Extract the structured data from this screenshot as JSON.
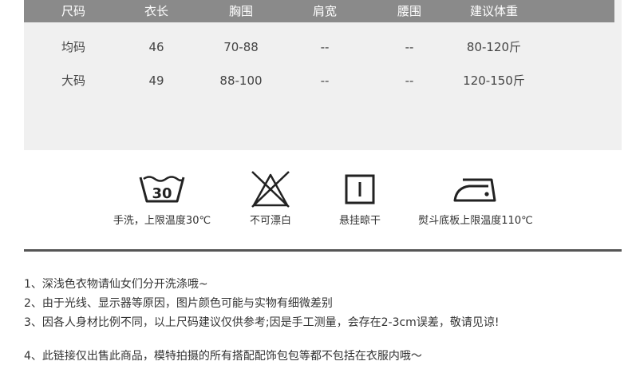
{
  "size_table": {
    "headers": [
      "尺码",
      "衣长",
      "胸围",
      "肩宽",
      "腰围",
      "建议体重"
    ],
    "rows": [
      [
        "均码",
        "46",
        "70-88",
        "--",
        "--",
        "80-120斤"
      ],
      [
        "大码",
        "49",
        "88-100",
        "--",
        "--",
        "120-150斤"
      ]
    ]
  },
  "care": {
    "items": [
      {
        "icon": "wash-30-icon",
        "icon_text": "30",
        "label": "手洗，上限温度30℃"
      },
      {
        "icon": "no-bleach-icon",
        "label": "不可漂白"
      },
      {
        "icon": "hang-dry-icon",
        "label": "悬挂晾干"
      },
      {
        "icon": "iron-icon",
        "label": "熨斗底板上限温度110℃"
      }
    ]
  },
  "notes": [
    "1、深浅色衣物请仙女们分开洗涤哦~",
    "2、由于光线、显示器等原因，图片颜色可能与实物有细微差别",
    "3、因各人身材比例不同，以上尺码建议仅供参考;因是手工测量，会存在2-3cm误差，敬请见谅!",
    "4、此链接仅出售此商品，模特拍摄的所有搭配配饰包包等都不包括在衣服内哦～"
  ]
}
